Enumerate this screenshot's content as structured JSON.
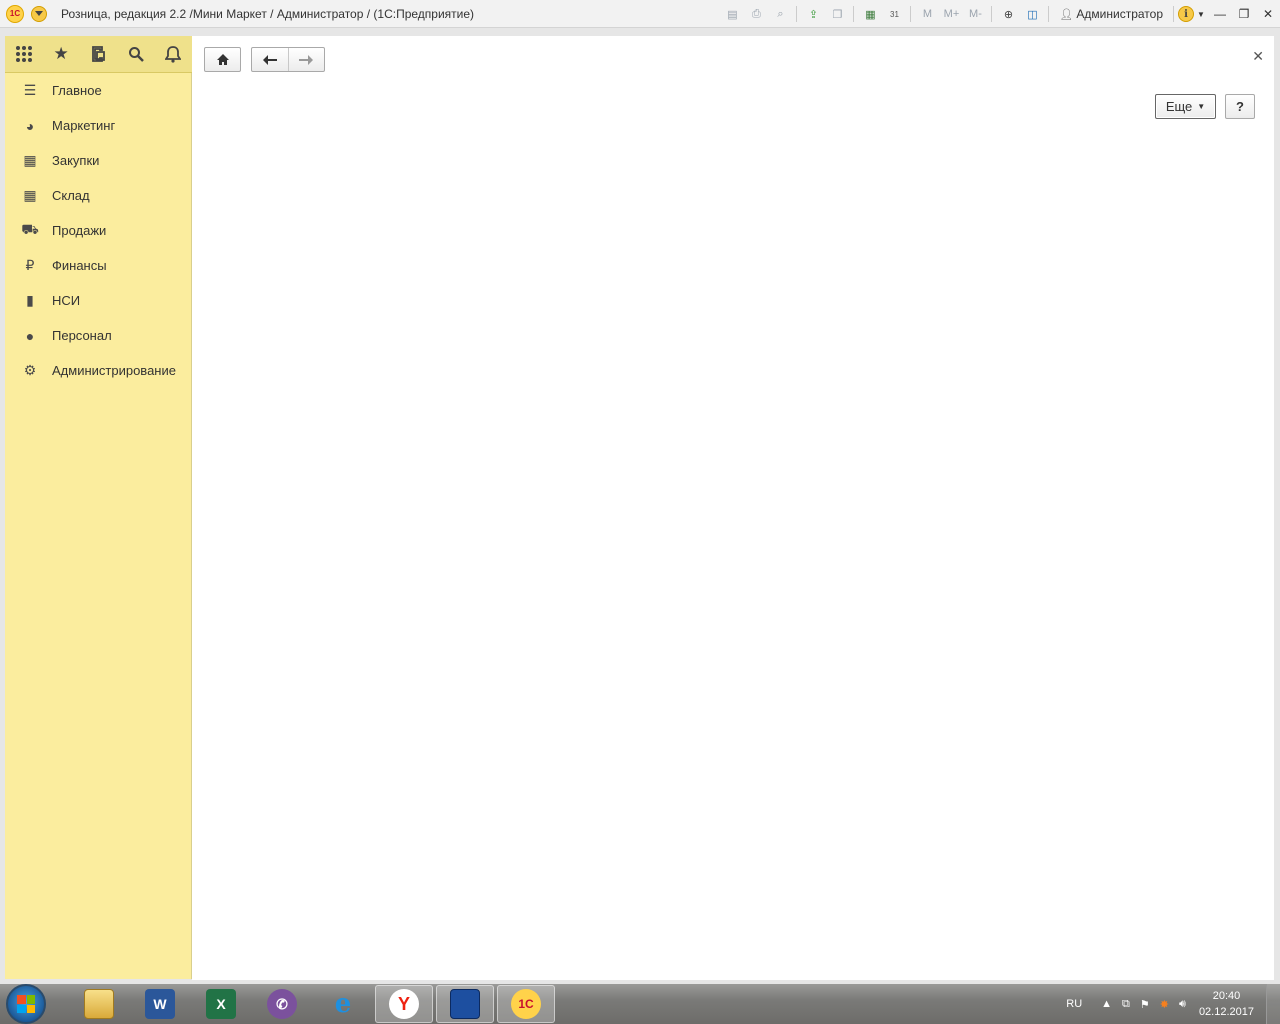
{
  "window": {
    "title": "Розница, редакция 2.2 /Мини Маркет / Администратор /  (1С:Предприятие)",
    "user": "Администратор",
    "toolbar_icons": [
      "save-icon",
      "print-icon",
      "preview-icon",
      "upload-icon",
      "copy-icon",
      "calculator-icon",
      "calendar-icon",
      "m-icon",
      "m-plus-icon",
      "m-minus-icon",
      "zoom-icon",
      "panels-icon"
    ],
    "memory_labels": [
      "M",
      "M+",
      "M-"
    ],
    "calendar_day": "31"
  },
  "sidebar": {
    "top_icons": [
      "apps-grid-icon",
      "favorites-star-icon",
      "history-icon",
      "search-icon",
      "bell-icon"
    ],
    "items": [
      {
        "label": "Главное",
        "icon": "menu-lines-icon"
      },
      {
        "label": "Маркетинг",
        "icon": "pie-chart-icon"
      },
      {
        "label": "Закупки",
        "icon": "cart-icon"
      },
      {
        "label": "Склад",
        "icon": "warehouse-grid-icon"
      },
      {
        "label": "Продажи",
        "icon": "basket-icon"
      },
      {
        "label": "Финансы",
        "icon": "ruble-icon"
      },
      {
        "label": "НСИ",
        "icon": "books-icon"
      },
      {
        "label": "Персонал",
        "icon": "person-icon"
      },
      {
        "label": "Администрирование",
        "icon": "gear-icon"
      }
    ]
  },
  "main": {
    "more_label": "Еще",
    "help_label": "?"
  },
  "taskbar": {
    "apps": [
      "explorer",
      "word",
      "excel",
      "viber",
      "internet-explorer",
      "yandex-browser",
      "save-app",
      "1c-enterprise"
    ],
    "lang": "RU",
    "time": "20:40",
    "date": "02.12.2017"
  }
}
